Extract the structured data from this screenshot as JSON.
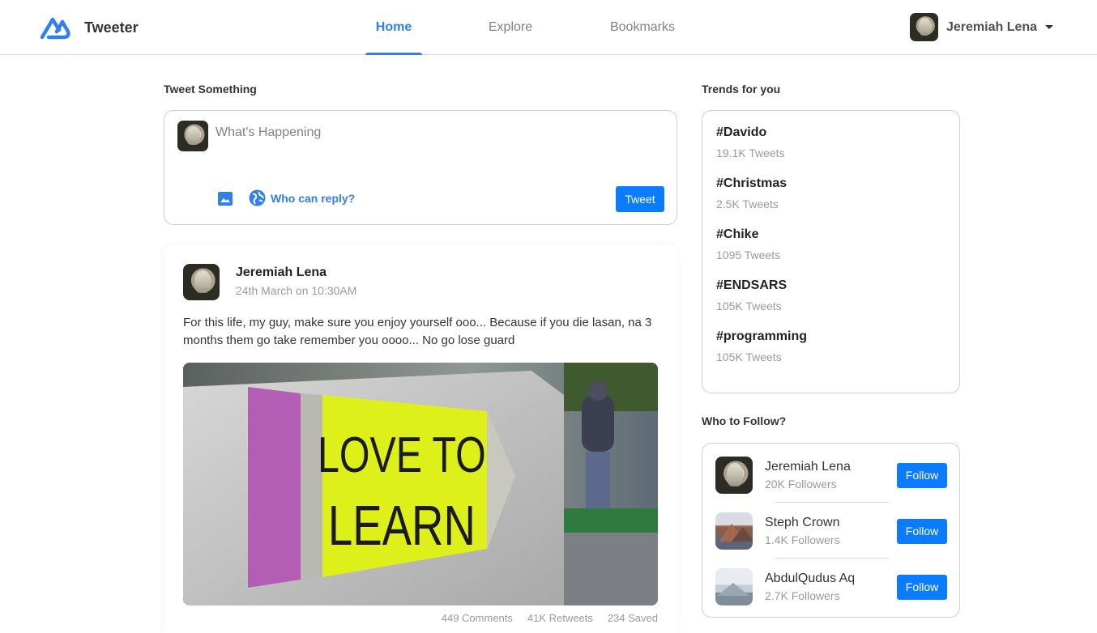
{
  "brand": {
    "name": "Tweeter",
    "logo_icon": "tweeter-logo-icon",
    "accent": "#2f80ed"
  },
  "nav": {
    "tabs": [
      {
        "label": "Home",
        "active": true
      },
      {
        "label": "Explore",
        "active": false
      },
      {
        "label": "Bookmarks",
        "active": false
      }
    ]
  },
  "user": {
    "name": "Jeremiah Lena",
    "menu_icon": "caret-down-icon"
  },
  "composer": {
    "section_title": "Tweet Something",
    "placeholder": "What's Happening",
    "image_icon": "image-icon",
    "reply_icon": "globe-icon",
    "reply_label": "Who can reply?",
    "submit_label": "Tweet"
  },
  "post": {
    "author": "Jeremiah Lena",
    "date": "24th March on 10:30AM",
    "text": "For this life, my guy, make sure you enjoy yourself ooo... Because if you die lasan, na 3 months them go take remember you oooo... No go lose guard",
    "image_text_line1": "LOVE TO",
    "image_text_line2": "LEARN",
    "stats": {
      "comments": "449 Comments",
      "retweets": "41K Retweets",
      "saved": "234 Saved"
    }
  },
  "trends": {
    "title": "Trends for you",
    "items": [
      {
        "tag": "#Davido",
        "count": "19.1K Tweets"
      },
      {
        "tag": "#Christmas",
        "count": "2.5K Tweets"
      },
      {
        "tag": "#Chike",
        "count": "1095 Tweets"
      },
      {
        "tag": "#ENDSARS",
        "count": "105K Tweets"
      },
      {
        "tag": "#programming",
        "count": "105K Tweets"
      }
    ]
  },
  "who_to_follow": {
    "title": "Who to Follow?",
    "items": [
      {
        "name": "Jeremiah Lena",
        "followers": "20K Followers",
        "button": "Follow"
      },
      {
        "name": "Steph Crown",
        "followers": "1.4K Followers",
        "button": "Follow"
      },
      {
        "name": "AbdulQudus Aq",
        "followers": "2.7K Followers",
        "button": "Follow"
      }
    ]
  },
  "colors": {
    "primary_button": "#0b7bff",
    "muted_text": "#9a9a9a"
  }
}
